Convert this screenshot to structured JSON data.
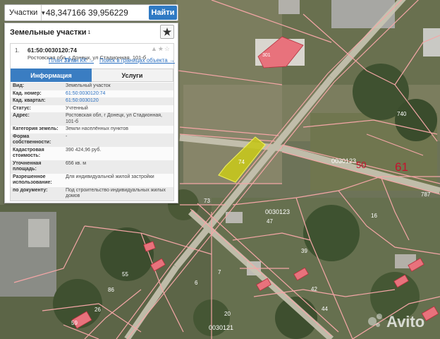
{
  "search": {
    "layer": "Участки",
    "value": "48,347166 39,956229",
    "button": "Найти"
  },
  "panel": {
    "title": "Земельные участки",
    "count": "1"
  },
  "result": {
    "index": "1.",
    "cad_number": "61:50:0030120:74",
    "address": "Ростовская обл, г Донецк, ул Стадионная, 101-б",
    "links": {
      "plan_zu": "План ЗУ →",
      "plan_kk": "План КК →",
      "search_within": "Поиск в границах объекта →"
    },
    "tabs": {
      "info": "Информация",
      "services": "Услуги"
    },
    "fields": [
      {
        "key": "Вид:",
        "value": "Земельный участок",
        "link": false
      },
      {
        "key": "Кад. номер:",
        "value": "61:50:0030120:74",
        "link": true
      },
      {
        "key": "Кад. квартал:",
        "value": "61:50:0030120",
        "link": true
      },
      {
        "key": "Статус:",
        "value": "Учтенный",
        "link": false
      },
      {
        "key": "Адрес:",
        "value": "Ростовская обл, г Донецк, ул Стадионная, 101-б",
        "link": false
      },
      {
        "key": "Категория земель:",
        "value": "Земли населённых пунктов",
        "link": false
      },
      {
        "key": "Форма собственности:",
        "value": "-",
        "link": false
      },
      {
        "key": "Кадастровая стоимость:",
        "value": "390 424,96 руб.",
        "link": false
      },
      {
        "key": "Уточненная площадь:",
        "value": "656 кв. м",
        "link": false
      },
      {
        "key": "Разрешенное использование:",
        "value": "Для индивидуальной жилой застройки",
        "link": false
      },
      {
        "key": "по документу:",
        "value": "Под строительство индивидуальных жилых домов",
        "link": false
      }
    ]
  },
  "map_labels": {
    "parcel_selected": "74",
    "block_top": "0030123",
    "block_mid": "0030123",
    "block_bottom": "0030121",
    "big_50": "50",
    "big_61": "61",
    "n740": "740",
    "n73": "73",
    "n47": "47",
    "n16": "16",
    "n787": "787",
    "n55": "55",
    "n86": "86",
    "n7": "7",
    "n6": "6",
    "n39": "39",
    "n42": "42",
    "n44": "44",
    "n20": "20",
    "n26": "26",
    "n59": "59",
    "n301": "301",
    "watermark": "Avito"
  },
  "colors": {
    "accent": "#3a7dc2",
    "parcel_border": "#f4a6a6",
    "selected_fill": "#d4d400"
  }
}
